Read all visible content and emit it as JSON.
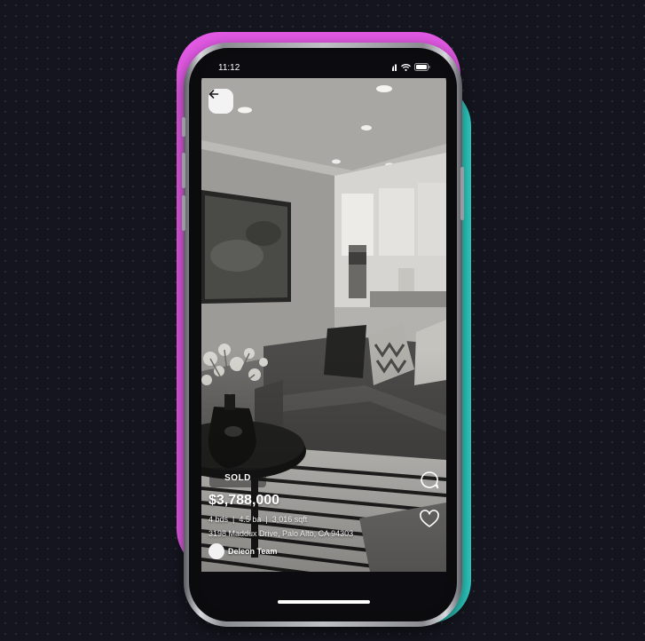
{
  "status_bar": {
    "time": "11:12",
    "icons": [
      "signal-icon",
      "wifi-icon",
      "battery-icon"
    ]
  },
  "navigation": {
    "back_icon": "arrow-left-icon"
  },
  "listing": {
    "status": "SOLD",
    "price": "$3,788,000",
    "beds": "4 bds",
    "baths": "4.5 ba",
    "sqft": "3,016 sqft",
    "separator": "|",
    "address": "3198 Maddux Drive, Palo Alto, CA 94303",
    "agent_name": "Deleon Team"
  },
  "actions": {
    "comment_icon": "comment-icon",
    "like_icon": "heart-icon"
  },
  "colors": {
    "background": "#15151f",
    "accent_pink": "#e45ae6",
    "accent_teal": "#2fd2c7"
  }
}
